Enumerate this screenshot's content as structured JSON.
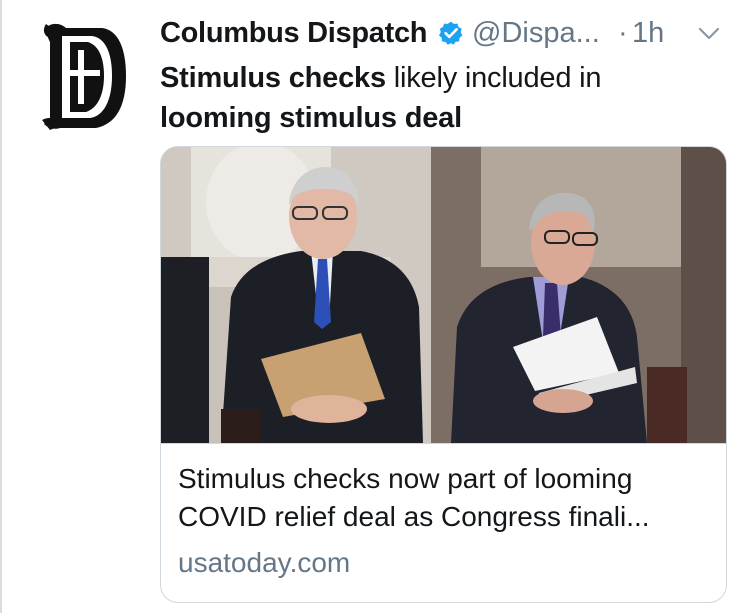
{
  "author": {
    "name": "Columbus Dispatch",
    "handle": "@Dispa...",
    "separator": "·",
    "time": "1h",
    "avatar_letter": "D",
    "verified_icon": "verified-badge-icon"
  },
  "tweet": {
    "text_bold_1": "Stimulus checks",
    "text_plain": " likely included in",
    "text_bold_2": "looming stimulus deal"
  },
  "card": {
    "title_line1": "Stimulus checks now part of looming",
    "title_line2": "COVID relief deal as Congress finali...",
    "domain": "usatoday.com"
  },
  "colors": {
    "verified": "#1da1f2",
    "secondary_text": "#657786",
    "card_border": "#cfd8de"
  }
}
